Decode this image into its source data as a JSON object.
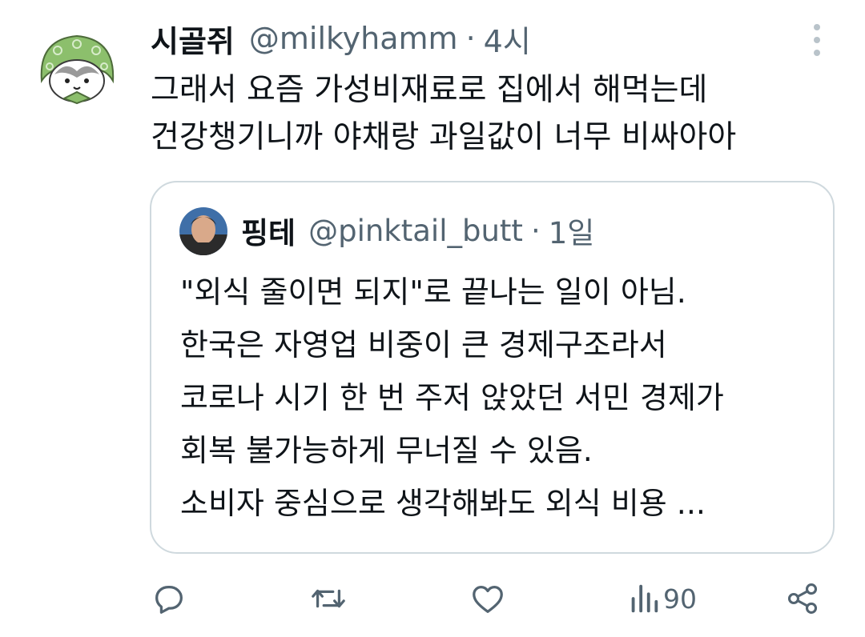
{
  "tweet": {
    "display_name": "시골쥐",
    "handle": "@milkyhamm",
    "separator": "·",
    "time": "4시",
    "text_lines": [
      "그래서 요즘 가성비재료로 집에서 해먹는데",
      "건강챙기니까 야채랑 과일값이 너무 비싸아아"
    ],
    "avatar_icon": "hamster-avatar-icon"
  },
  "quote": {
    "display_name": "핑테",
    "handle": "@pinktail_butt",
    "separator": "·",
    "time": "1일",
    "text_lines": [
      "\"외식 줄이면 되지\"로 끝나는 일이 아님.",
      "한국은 자영업 비중이 큰 경제구조라서",
      "코로나 시기 한 번 주저 앉았던 서민 경제가",
      "회복 불가능하게 무너질 수 있음.",
      "소비자 중심으로 생각해봐도 외식 비용 ..."
    ]
  },
  "actions": {
    "reply_icon": "reply-icon",
    "retweet_icon": "retweet-icon",
    "like_icon": "heart-icon",
    "views_icon": "views-icon",
    "views_count": "90",
    "share_icon": "share-icon"
  },
  "colors": {
    "text": "#0f1419",
    "secondary": "#536471",
    "border": "#cfd9de",
    "avatar_green": "#8cbf6c"
  }
}
